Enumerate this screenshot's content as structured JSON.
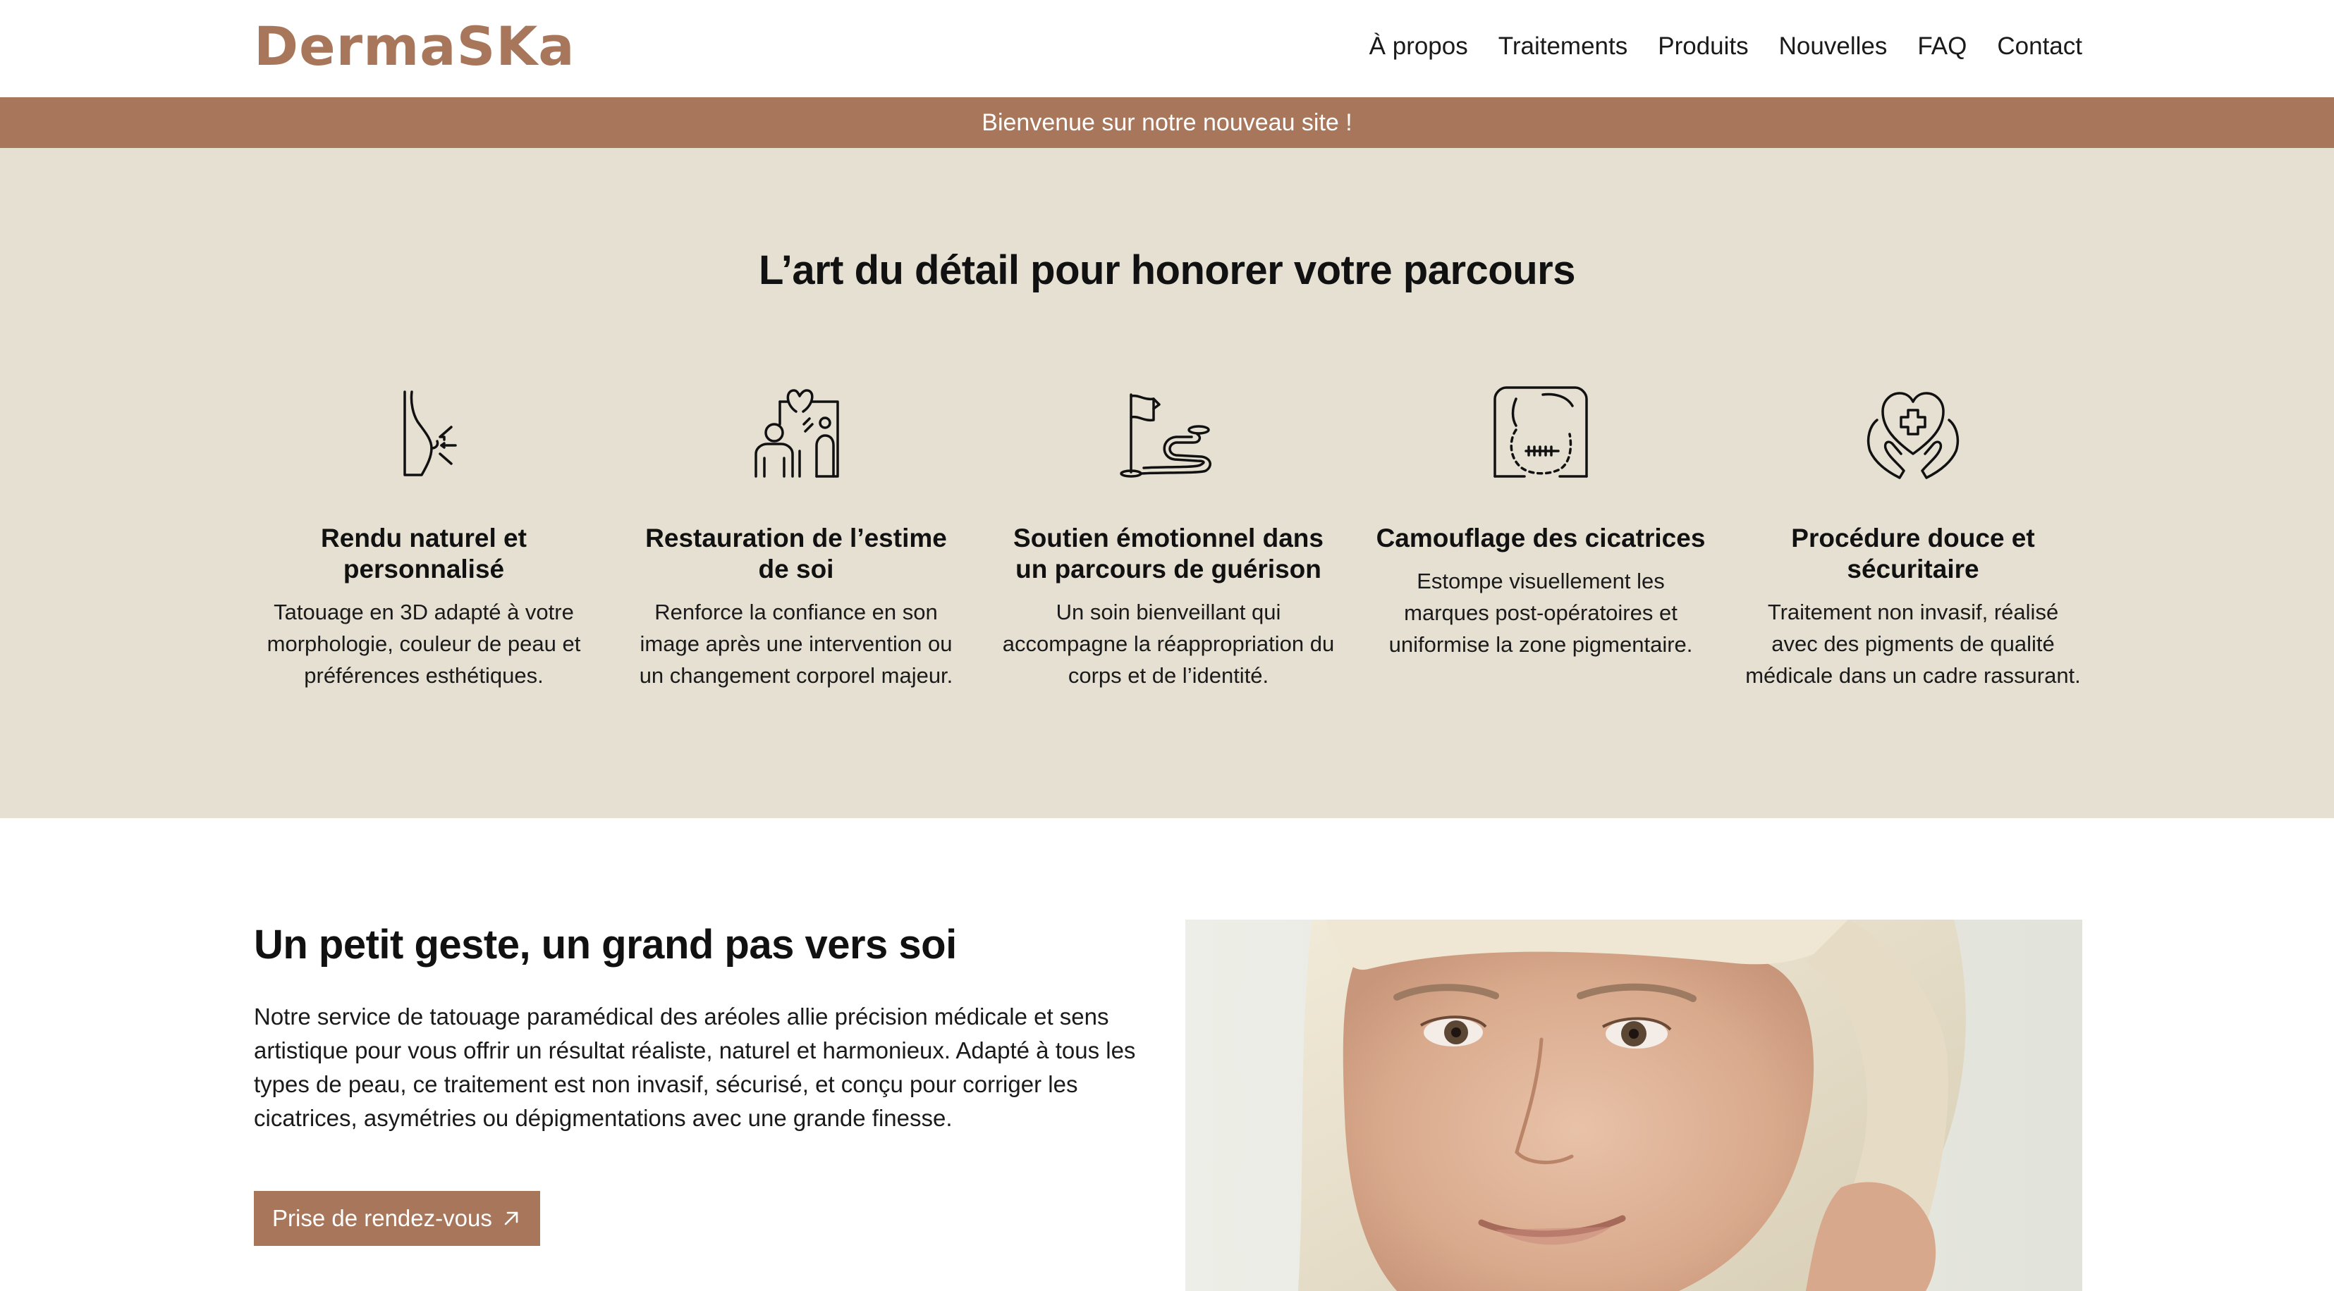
{
  "header": {
    "logo": "DermaSKa",
    "nav": [
      "À propos",
      "Traitements",
      "Produits",
      "Nouvelles",
      "FAQ",
      "Contact"
    ]
  },
  "announcement": "Bienvenue sur notre nouveau site !",
  "features": {
    "title": "L’art du détail pour honorer votre parcours",
    "items": [
      {
        "icon": "breast-icon",
        "title": "Rendu naturel et personnalisé",
        "text": "Tatouage en 3D adapté à votre morphologie, couleur de peau et préférences esthétiques."
      },
      {
        "icon": "self-esteem-mirror-icon",
        "title": "Restauration de l’estime de soi",
        "text": "Renforce la confiance en son image après une intervention ou un changement corporel majeur."
      },
      {
        "icon": "flag-path-icon",
        "title": "Soutien émotionnel dans un parcours de guérison",
        "text": "Un soin bienveillant qui accompagne la réappropriation du corps et de l’identité."
      },
      {
        "icon": "scar-icon",
        "title": "Camouflage des cicatrices",
        "text": "Estompe visuellement les marques post-opératoires et uniformise la zone pigmentaire."
      },
      {
        "icon": "hands-heart-icon",
        "title": "Procédure douce et sécuritaire",
        "text": "Traitement non invasif, réalisé avec des pigments de qualité médicale dans un cadre rassurant."
      }
    ]
  },
  "intro": {
    "title": "Un petit geste, un grand pas vers soi",
    "text": "Notre service de tatouage paramédical des aréoles allie précision médicale et sens artistique pour vous offrir un résultat réaliste, naturel et harmonieux. Adapté à tous les types de peau, ce traitement est non invasif, sécurisé, et conçu pour corriger les cicatrices, asymétries ou dépigmentations avec une grande finesse.",
    "cta": "Prise de rendez-vous"
  },
  "colors": {
    "brand": "#a8775b",
    "beige": "#e6e0d3"
  }
}
